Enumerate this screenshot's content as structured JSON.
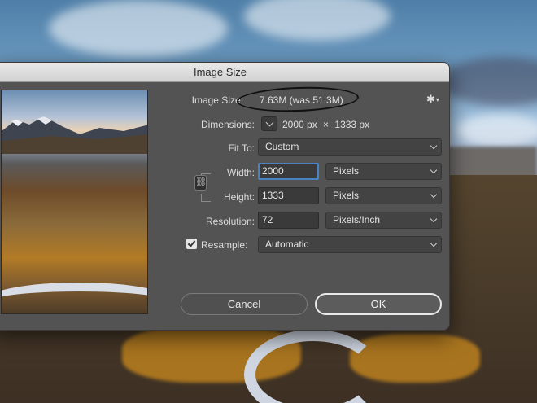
{
  "window": {
    "title": "Image Size"
  },
  "image_size": {
    "label": "Image Size:",
    "value": "7.63M (was 51.3M)"
  },
  "dimensions": {
    "label": "Dimensions:",
    "width": "2000 px",
    "separator": "×",
    "height": "1333 px"
  },
  "fit_to": {
    "label": "Fit To:",
    "value": "Custom"
  },
  "width": {
    "label": "Width:",
    "value": "2000",
    "unit": "Pixels"
  },
  "height": {
    "label": "Height:",
    "value": "1333",
    "unit": "Pixels"
  },
  "resolution": {
    "label": "Resolution:",
    "value": "72",
    "unit": "Pixels/Inch"
  },
  "resample": {
    "label": "Resample:",
    "checked": true,
    "value": "Automatic"
  },
  "buttons": {
    "cancel": "Cancel",
    "ok": "OK"
  },
  "icons": {
    "settings": "gear-icon",
    "constrain": "chain-link-icon",
    "dimensions_menu": "chevron-down-icon"
  },
  "colors": {
    "accent_focus": "#4b82c3",
    "dialog_bg": "#535353"
  }
}
